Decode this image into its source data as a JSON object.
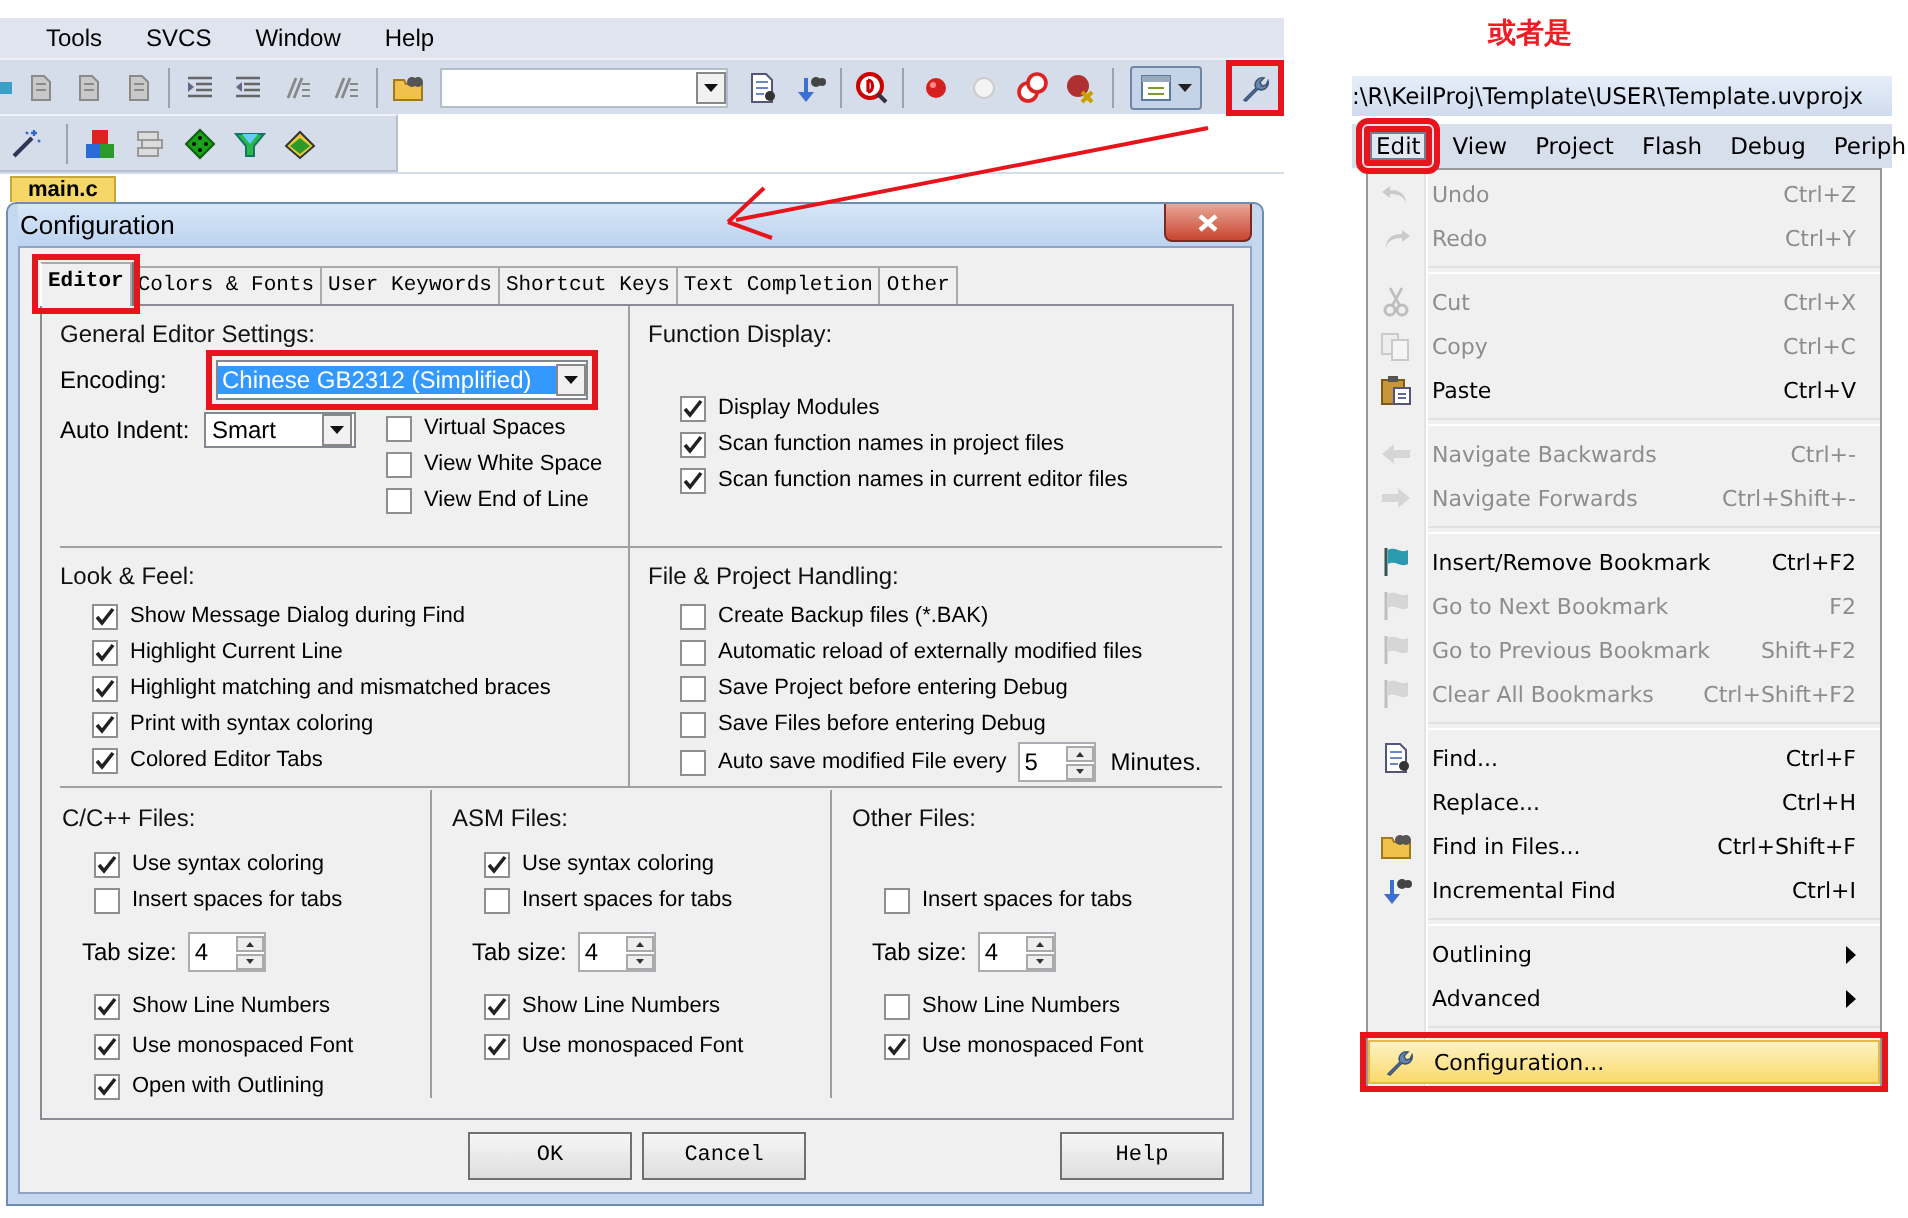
{
  "menu_bar": [
    {
      "label": "Tools"
    },
    {
      "label": "SVCS"
    },
    {
      "label": "Window"
    },
    {
      "label": "Help"
    }
  ],
  "toolbar": {
    "settings_highlighted": true
  },
  "editor_tab": "main.c",
  "dialog": {
    "title": "Configuration",
    "tabs": [
      {
        "label": "Editor",
        "selected": true,
        "highlighted": true
      },
      {
        "label": "Colors & Fonts",
        "selected": false,
        "highlighted": false
      },
      {
        "label": "User Keywords",
        "selected": false,
        "highlighted": false
      },
      {
        "label": "Shortcut Keys",
        "selected": false,
        "highlighted": false
      },
      {
        "label": "Text Completion",
        "selected": false,
        "highlighted": false
      },
      {
        "label": "Other",
        "selected": false,
        "highlighted": false
      }
    ],
    "general": {
      "heading": "General Editor Settings:",
      "encoding_label": "Encoding:",
      "encoding": "Chinese GB2312 (Simplified)",
      "encoding_highlighted": true,
      "indent_label": "Auto Indent:",
      "indent": "Smart",
      "options": [
        {
          "label": "Virtual Spaces",
          "checked": false
        },
        {
          "label": "View White Space",
          "checked": false
        },
        {
          "label": "View End of Line",
          "checked": false
        }
      ]
    },
    "function_display": {
      "heading": "Function Display:",
      "options": [
        {
          "label": "Display Modules",
          "checked": true
        },
        {
          "label": "Scan function names in project files",
          "checked": true
        },
        {
          "label": "Scan function names in current editor files",
          "checked": true
        }
      ]
    },
    "look_feel": {
      "heading": "Look & Feel:",
      "options": [
        {
          "label": "Show Message Dialog during Find",
          "checked": true
        },
        {
          "label": "Highlight Current Line",
          "checked": true
        },
        {
          "label": "Highlight matching and mismatched braces",
          "checked": true
        },
        {
          "label": "Print with syntax coloring",
          "checked": true
        },
        {
          "label": "Colored Editor Tabs",
          "checked": true
        }
      ]
    },
    "file_handling": {
      "heading": "File & Project Handling:",
      "options": [
        {
          "label": "Create Backup files (*.BAK)",
          "checked": false
        },
        {
          "label": "Automatic reload of externally modified files",
          "checked": false
        },
        {
          "label": "Save Project before entering Debug",
          "checked": false
        },
        {
          "label": "Save Files before entering Debug",
          "checked": false
        }
      ],
      "autosave": {
        "label": "Auto save modified File every",
        "checked": false,
        "value": "5",
        "unit": "Minutes."
      }
    },
    "file_types": [
      {
        "heading": "C/C++ Files:",
        "top_options": [
          {
            "label": "Use syntax coloring",
            "checked": true
          },
          {
            "label": "Insert spaces for tabs",
            "checked": false
          }
        ],
        "tab_size_label": "Tab size:",
        "tab_size": "4",
        "bottom_options": [
          {
            "label": "Show Line Numbers",
            "checked": true
          },
          {
            "label": "Use monospaced Font",
            "checked": true
          },
          {
            "label": "Open with Outlining",
            "checked": true
          }
        ]
      },
      {
        "heading": "ASM Files:",
        "top_options": [
          {
            "label": "Use syntax coloring",
            "checked": true
          },
          {
            "label": "Insert spaces for tabs",
            "checked": false
          }
        ],
        "tab_size_label": "Tab size:",
        "tab_size": "4",
        "bottom_options": [
          {
            "label": "Show Line Numbers",
            "checked": true
          },
          {
            "label": "Use monospaced Font",
            "checked": true
          }
        ]
      },
      {
        "heading": "Other Files:",
        "top_options": [
          {
            "label": "Insert spaces for tabs",
            "checked": false
          }
        ],
        "tab_size_label": "Tab size:",
        "tab_size": "4",
        "bottom_options": [
          {
            "label": "Show Line Numbers",
            "checked": false
          },
          {
            "label": "Use monospaced Font",
            "checked": true
          }
        ]
      }
    ],
    "buttons": [
      {
        "label": "OK"
      },
      {
        "label": "Cancel"
      },
      {
        "label": "Help"
      }
    ]
  },
  "note": "或者是",
  "second_window": {
    "path": ":\\R\\KeilProj\\Template\\USER\\Template.uvprojx",
    "menu_bar": [
      {
        "label": "Edit",
        "selected": true,
        "highlighted": true
      },
      {
        "label": "View",
        "selected": false,
        "highlighted": false
      },
      {
        "label": "Project",
        "selected": false,
        "highlighted": false
      },
      {
        "label": "Flash",
        "selected": false,
        "highlighted": false
      },
      {
        "label": "Debug",
        "selected": false,
        "highlighted": false
      },
      {
        "label": "Periph",
        "selected": false,
        "highlighted": false
      }
    ],
    "edit_menu": [
      {
        "kind": "item",
        "label": "Undo",
        "shortcut": "Ctrl+Z",
        "disabled": true,
        "selected": false,
        "highlighted": false
      },
      {
        "kind": "item",
        "label": "Redo",
        "shortcut": "Ctrl+Y",
        "disabled": true,
        "selected": false,
        "highlighted": false
      },
      {
        "kind": "separator"
      },
      {
        "kind": "item",
        "label": "Cut",
        "shortcut": "Ctrl+X",
        "disabled": true,
        "selected": false,
        "highlighted": false
      },
      {
        "kind": "item",
        "label": "Copy",
        "shortcut": "Ctrl+C",
        "disabled": true,
        "selected": false,
        "highlighted": false
      },
      {
        "kind": "item",
        "label": "Paste",
        "shortcut": "Ctrl+V",
        "disabled": false,
        "selected": false,
        "highlighted": false
      },
      {
        "kind": "separator"
      },
      {
        "kind": "item",
        "label": "Navigate Backwards",
        "shortcut": "Ctrl+-",
        "disabled": true,
        "selected": false,
        "highlighted": false
      },
      {
        "kind": "item",
        "label": "Navigate Forwards",
        "shortcut": "Ctrl+Shift+-",
        "disabled": true,
        "selected": false,
        "highlighted": false
      },
      {
        "kind": "separator"
      },
      {
        "kind": "item",
        "label": "Insert/Remove Bookmark",
        "shortcut": "Ctrl+F2",
        "disabled": false,
        "selected": false,
        "highlighted": false
      },
      {
        "kind": "item",
        "label": "Go to Next Bookmark",
        "shortcut": "F2",
        "disabled": true,
        "selected": false,
        "highlighted": false
      },
      {
        "kind": "item",
        "label": "Go to Previous Bookmark",
        "shortcut": "Shift+F2",
        "disabled": true,
        "selected": false,
        "highlighted": false
      },
      {
        "kind": "item",
        "label": "Clear All Bookmarks",
        "shortcut": "Ctrl+Shift+F2",
        "disabled": true,
        "selected": false,
        "highlighted": false
      },
      {
        "kind": "separator"
      },
      {
        "kind": "item",
        "label": "Find...",
        "shortcut": "Ctrl+F",
        "disabled": false,
        "selected": false,
        "highlighted": false
      },
      {
        "kind": "item",
        "label": "Replace...",
        "shortcut": "Ctrl+H",
        "disabled": false,
        "selected": false,
        "highlighted": false
      },
      {
        "kind": "item",
        "label": "Find in Files...",
        "shortcut": "Ctrl+Shift+F",
        "disabled": false,
        "selected": false,
        "highlighted": false
      },
      {
        "kind": "item",
        "label": "Incremental Find",
        "shortcut": "Ctrl+I",
        "disabled": false,
        "selected": false,
        "highlighted": false
      },
      {
        "kind": "separator"
      },
      {
        "kind": "submenu",
        "label": "Outlining",
        "disabled": false,
        "selected": false,
        "highlighted": false
      },
      {
        "kind": "submenu",
        "label": "Advanced",
        "disabled": false,
        "selected": false,
        "highlighted": false
      },
      {
        "kind": "separator"
      },
      {
        "kind": "item",
        "label": "Configuration...",
        "disabled": false,
        "selected": true,
        "highlighted": true
      }
    ]
  }
}
